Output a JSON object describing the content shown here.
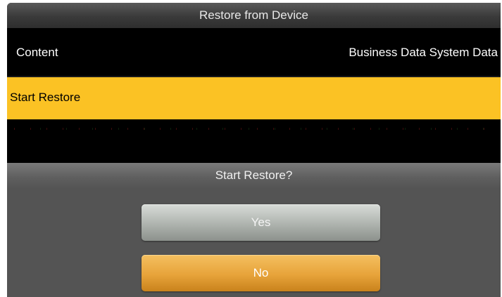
{
  "window": {
    "title": "Restore from Device"
  },
  "menu": {
    "content_row": {
      "label": "Content",
      "value": "Business Data System Data"
    },
    "start_row": {
      "label": "Start Restore"
    }
  },
  "dialog": {
    "title": "Start Restore?",
    "yes_label": "Yes",
    "no_label": "No"
  },
  "colors": {
    "highlight": "#fbc224",
    "no_button": "#e7a33a",
    "yes_button": "#aeb3ae",
    "dialog_bg": "#545454"
  }
}
